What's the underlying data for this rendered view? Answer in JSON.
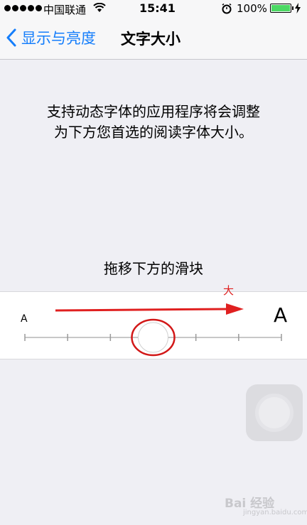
{
  "status_bar": {
    "carrier": "中国联通",
    "time": "15:41",
    "battery": "100%"
  },
  "nav": {
    "back_label": "显示与亮度",
    "title": "文字大小"
  },
  "content": {
    "description_line1": "支持动态字体的应用程序将会调整",
    "description_line2": "为下方您首选的阅读字体大小。",
    "hint": "拖移下方的滑块"
  },
  "slider": {
    "small_label": "A",
    "large_label": "A",
    "steps": 7,
    "value_index": 3
  },
  "annotation": {
    "label": "大",
    "color": "#e02020"
  },
  "watermark": {
    "text": "Bai 经验",
    "sub": "jingyan.baidu.com"
  },
  "colors": {
    "accent": "#157efb",
    "battery": "#4cd964"
  }
}
